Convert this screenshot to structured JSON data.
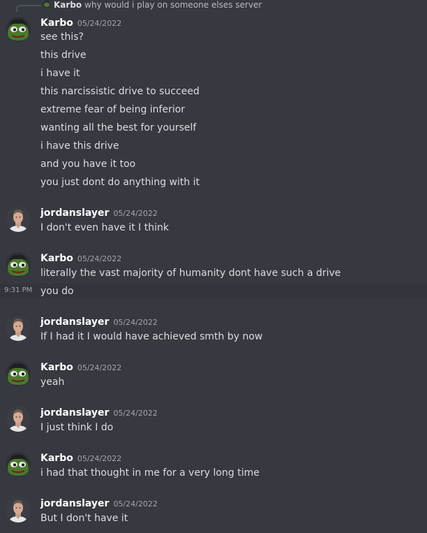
{
  "reply": {
    "author": "Karbo",
    "text": "why would i play on someone elses server"
  },
  "messages": [
    {
      "author": "Karbo",
      "avatar": "frog-avatar",
      "timestamp": "05/24/2022",
      "lines": [
        "see this?",
        "this drive",
        "i have it",
        "this narcissistic drive to succeed",
        "extreme fear of being inferior",
        "wanting all the best for yourself",
        "i have this drive",
        "and you have it too",
        "you just dont do anything with it"
      ]
    },
    {
      "author": "jordanslayer",
      "avatar": "person-avatar",
      "timestamp": "05/24/2022",
      "lines": [
        "I don't even have it I think"
      ]
    },
    {
      "author": "Karbo",
      "avatar": "frog-avatar",
      "timestamp": "05/24/2022",
      "lines": [
        "literally the vast majority of humanity dont have such a drive",
        "you do"
      ],
      "hover_time": "9:31 PM"
    },
    {
      "author": "jordanslayer",
      "avatar": "person-avatar",
      "timestamp": "05/24/2022",
      "lines": [
        "If I had it I would have achieved smth by now"
      ]
    },
    {
      "author": "Karbo",
      "avatar": "frog-avatar",
      "timestamp": "05/24/2022",
      "lines": [
        "yeah"
      ]
    },
    {
      "author": "jordanslayer",
      "avatar": "person-avatar",
      "timestamp": "05/24/2022",
      "lines": [
        "I just think I do"
      ]
    },
    {
      "author": "Karbo",
      "avatar": "frog-avatar",
      "timestamp": "05/24/2022",
      "lines": [
        "i had that thought in me for a very long time"
      ]
    },
    {
      "author": "jordanslayer",
      "avatar": "person-avatar",
      "timestamp": "05/24/2022",
      "lines": [
        "But I don't have it"
      ]
    }
  ]
}
